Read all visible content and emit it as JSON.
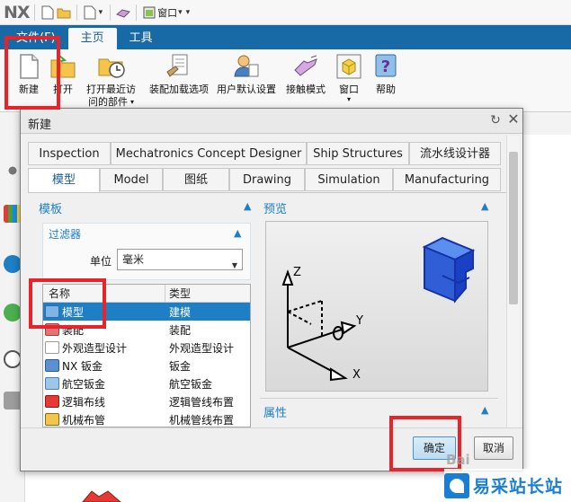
{
  "app": {
    "logo": "NX",
    "window_menu": "窗口"
  },
  "ribbon_tabs": [
    {
      "label": "文件(F)"
    },
    {
      "label": "主页"
    },
    {
      "label": "工具"
    }
  ],
  "ribbon": {
    "new": "新建",
    "open": "打开",
    "open_recent_1": "打开最近访",
    "open_recent_2": "问的部件",
    "assembly_load": "装配加载选项",
    "user_defaults": "用户默认设置",
    "touch_mode": "接触模式",
    "window": "窗口",
    "help": "帮助"
  },
  "dialog": {
    "title": "新建",
    "tabs_row1": [
      "Inspection",
      "Mechatronics Concept Designer",
      "Ship Structures",
      "流水线设计器"
    ],
    "tabs_row2": [
      "模型",
      "Model",
      "图纸",
      "Drawing",
      "Simulation",
      "Manufacturing"
    ],
    "template_section": "模板",
    "filter_section": "过滤器",
    "unit_label": "单位",
    "unit_value": "毫米",
    "columns": [
      "名称",
      "类型"
    ],
    "rows": [
      {
        "name": "模型",
        "type": "建模"
      },
      {
        "name": "装配",
        "type": "装配"
      },
      {
        "name": "外观造型设计",
        "type": "外观造型设计"
      },
      {
        "name": "NX 钣金",
        "type": "钣金"
      },
      {
        "name": "航空钣金",
        "type": "航空钣金"
      },
      {
        "name": "逻辑布线",
        "type": "逻辑管线布置"
      },
      {
        "name": "机械布管",
        "type": "机械管线布置"
      }
    ],
    "preview_section": "预览",
    "properties_section": "属性",
    "ok": "确定",
    "cancel": "取消",
    "axes": {
      "x": "X",
      "y": "Y",
      "z": "Z"
    }
  },
  "watermark": {
    "baidu": "Bai",
    "site": "易采站长站"
  },
  "colors": {
    "ribbon_blue": "#186aa6",
    "accent": "#1e7fc4",
    "annotation_red": "#e8232a"
  }
}
